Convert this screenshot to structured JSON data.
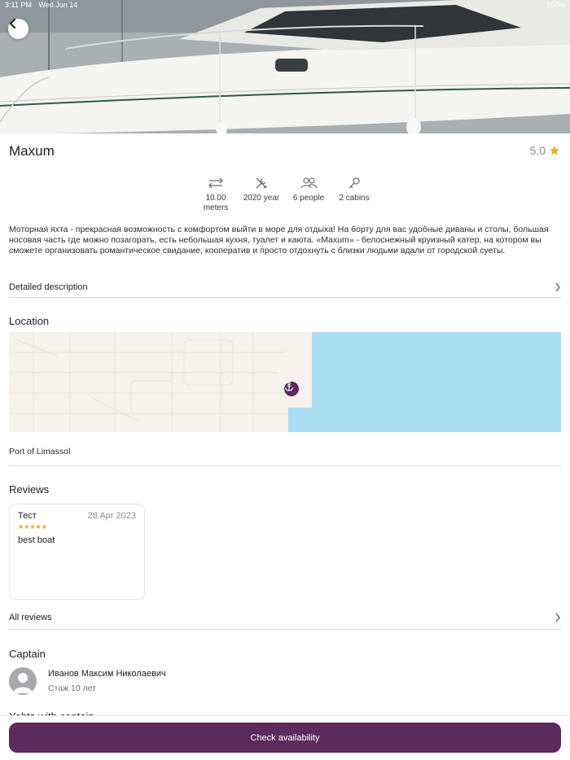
{
  "status_bar": {
    "time": "3:11 PM",
    "date": "Wed Jun 14",
    "battery": "100%"
  },
  "boat": {
    "name": "Maxum",
    "rating": "5.0"
  },
  "specs": [
    {
      "icon": "length-arrows-icon",
      "label": "10.00 meters"
    },
    {
      "icon": "tools-icon",
      "label": "2020 year"
    },
    {
      "icon": "people-icon",
      "label": "6 people"
    },
    {
      "icon": "key-icon",
      "label": "2 cabins"
    }
  ],
  "description": "Моторная яхта - прекрасная возможность с комфортом выйти в море для отдыха! На борту для вас удобные диваны и столы, большая носовая часть где можно позагорать, есть небольшая кухня, туалет и каюта. «Maxum» - белоснежный круизный катер, на котором вы сможете организовать романтическое свидание, кооператив и просто отдохнуть с близки людьми вдали от городской суеты.",
  "detailed_description_label": "Detailed description",
  "location": {
    "heading": "Location",
    "port": "Port of Limassol"
  },
  "reviews": {
    "heading": "Reviews",
    "items": [
      {
        "author": "Тест",
        "date": "28 Apr 2023",
        "stars": "★★★★★",
        "text": "best boat"
      }
    ],
    "all_label": "All reviews"
  },
  "captain": {
    "heading": "Captain",
    "name": "Иванов Максим Николаевич",
    "experience": "Стаж 10 лет"
  },
  "next_section_heading": "Yahts with captain",
  "cta_label": "Check availability",
  "colors": {
    "accent": "#5c2a5e",
    "star": "#f5a623",
    "water": "#aadcf2"
  }
}
